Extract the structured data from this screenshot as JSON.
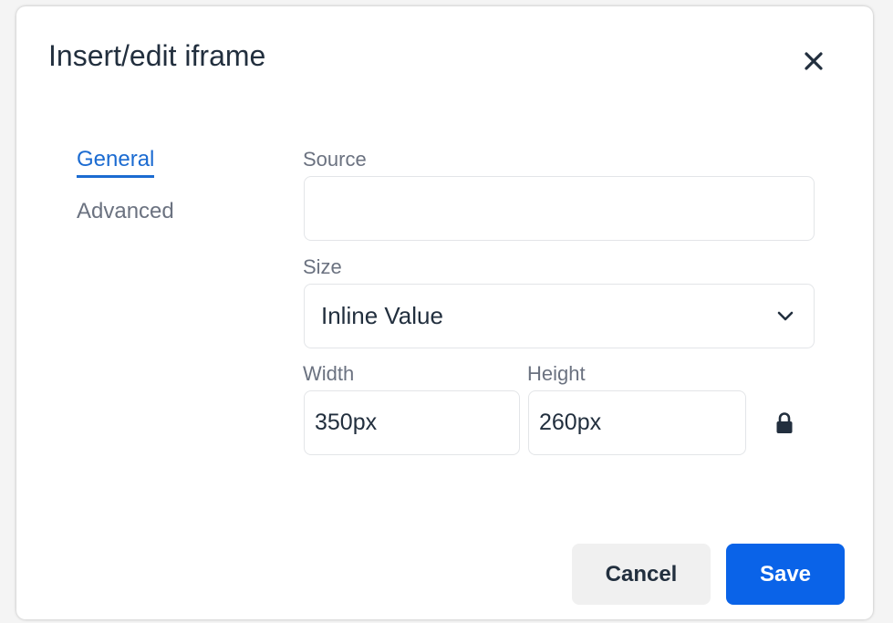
{
  "dialog": {
    "title": "Insert/edit iframe",
    "close_icon": "close-icon"
  },
  "tabs": [
    {
      "label": "General",
      "active": true
    },
    {
      "label": "Advanced",
      "active": false
    }
  ],
  "form": {
    "source": {
      "label": "Source",
      "value": ""
    },
    "size": {
      "label": "Size",
      "selected": "Inline Value"
    },
    "width": {
      "label": "Width",
      "value": "350px"
    },
    "height": {
      "label": "Height",
      "value": "260px"
    },
    "lock_icon": "lock-icon"
  },
  "footer": {
    "cancel_label": "Cancel",
    "save_label": "Save"
  },
  "colors": {
    "accent": "#1b6bd1",
    "primary_button": "#0a63e8",
    "secondary_button": "#f0f0f0",
    "text": "#222f3e",
    "muted": "#6b7280"
  }
}
